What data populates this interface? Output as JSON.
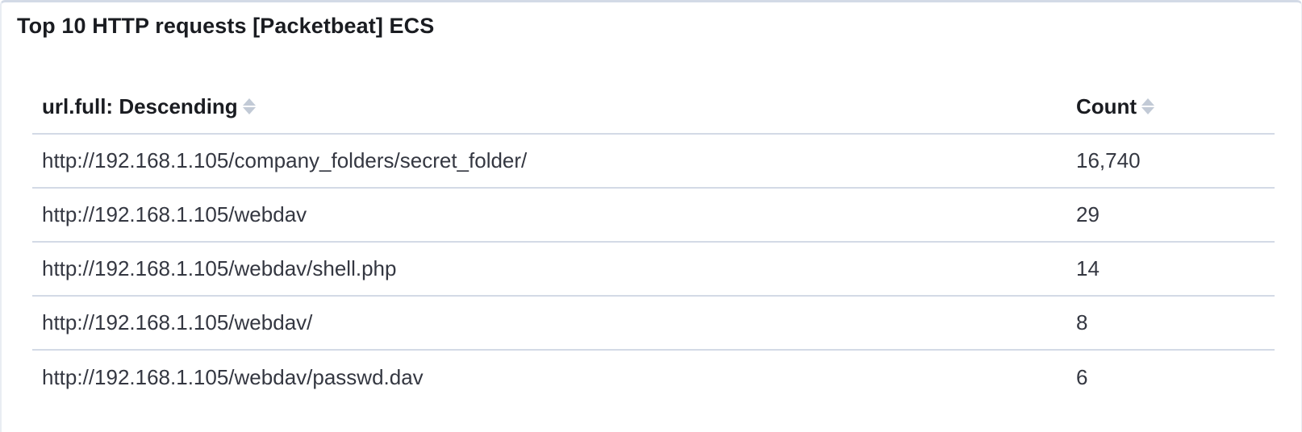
{
  "panel": {
    "title": "Top 10 HTTP requests [Packetbeat] ECS"
  },
  "table": {
    "columns": [
      {
        "label": "url.full: Descending",
        "sort_icon": "sort-icon"
      },
      {
        "label": "Count",
        "sort_icon": "sort-icon"
      }
    ],
    "rows": [
      {
        "url": "http://192.168.1.105/company_folders/secret_folder/",
        "count": "16,740"
      },
      {
        "url": "http://192.168.1.105/webdav",
        "count": "29"
      },
      {
        "url": "http://192.168.1.105/webdav/shell.php",
        "count": "14"
      },
      {
        "url": "http://192.168.1.105/webdav/",
        "count": "8"
      },
      {
        "url": "http://192.168.1.105/webdav/passwd.dav",
        "count": "6"
      }
    ]
  },
  "colors": {
    "text": "#343741",
    "heading": "#1a1c21",
    "border": "#d3dae6",
    "sort_icon": "#c2cad6"
  }
}
